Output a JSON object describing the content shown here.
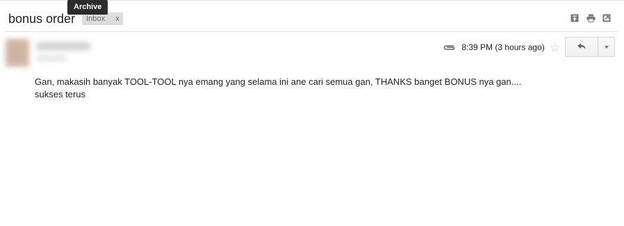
{
  "tooltip": {
    "text": "Archive"
  },
  "email": {
    "subject": "bonus order",
    "label": "Inbox",
    "label_remove": "x",
    "time": "8:39 PM (3 hours ago)",
    "body_line1": "Gan, makasih banyak TOOL-TOOL nya emang yang selama ini ane cari semua gan, THANKS banget BONUS nya gan....",
    "body_line2": "sukses terus"
  },
  "header_actions": [
    "archive-up-icon",
    "print-icon",
    "new-window-icon"
  ],
  "icons": {
    "attachment": "paperclip-icon",
    "star": "star-icon",
    "reply": "reply-arrow-icon",
    "more": "chevron-down-icon"
  },
  "colors": {
    "tooltip_bg": "#2c2c2c",
    "chip_bg": "#dddddd",
    "star": "#c6c6c6"
  }
}
